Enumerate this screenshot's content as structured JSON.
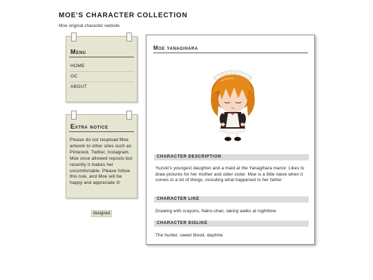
{
  "site": {
    "title": "MOE'S CHARACTER COLLECTION",
    "subtitle": "Moe original character website"
  },
  "sidebar": {
    "menu": {
      "title": "Menu",
      "items": [
        {
          "label": "HOME"
        },
        {
          "label": "OC"
        },
        {
          "label": "ABOUT"
        }
      ]
    },
    "extra_notice": {
      "title": "Extra notice",
      "text": "Please do not reupload Moe artwork to other sites such as Pinterest, Twitter, Instagram. Moe once allowed reposts but recently it makes her uncomfortable. Please follow this rule, and Moe will be happy and appreciate it!"
    },
    "credit_label": "designed"
  },
  "character": {
    "name": "Moe yanagihara",
    "sections": [
      {
        "heading": "CHARACTER DESCRIPTION",
        "body": "Yuzuki's youngest daughter and a maid at the Yanagihara manor. Likes to draw pictures for her mother and older sister. Moe is a little naive when it comes to a lot of things, including what happened to her father"
      },
      {
        "heading": "CHARACTER LIKE",
        "body": "Drawing with crayons, Naho-chan, taking walks at nighttime"
      },
      {
        "heading": "CHARACTER DISLIKE",
        "body": "The hunter, sweet blood, daytime"
      }
    ]
  },
  "colors": {
    "note_paper": "#e7e7d4",
    "section_header_bg": "#dcdcdc",
    "hair": "#e68a1a",
    "dress": "#2a2120"
  }
}
